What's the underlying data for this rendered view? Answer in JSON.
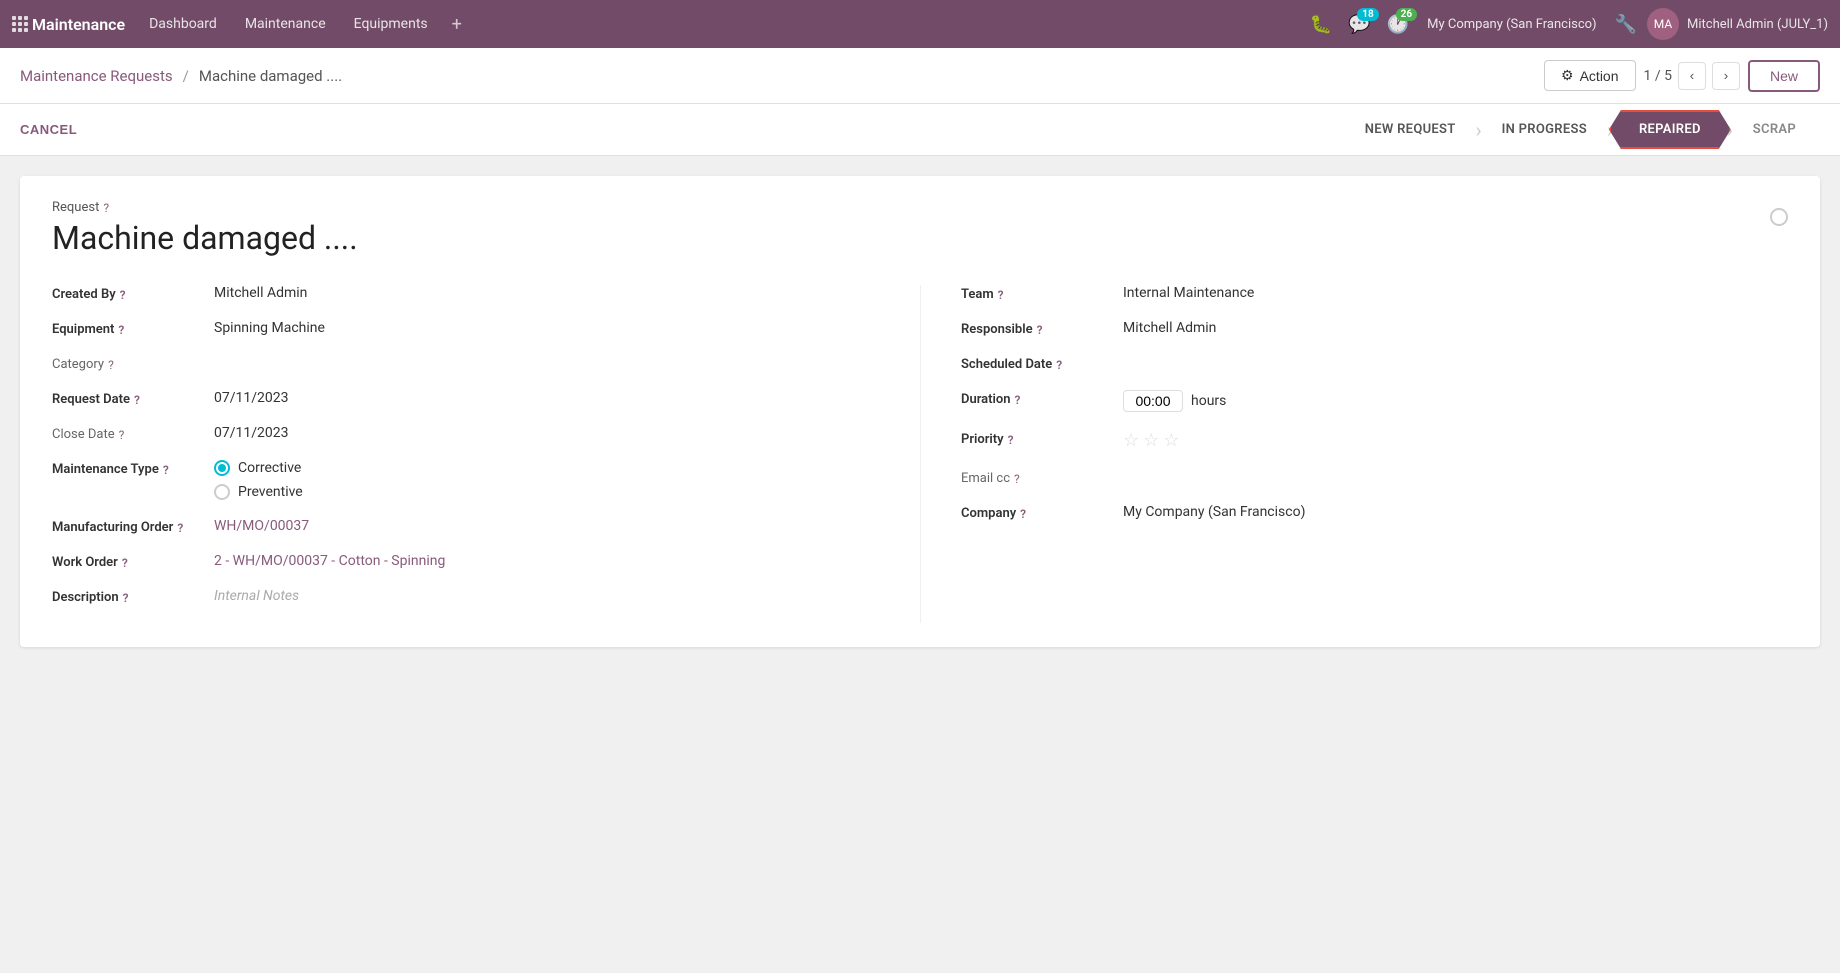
{
  "topNav": {
    "brand": "Maintenance",
    "items": [
      "Dashboard",
      "Maintenance",
      "Equipments"
    ],
    "addLabel": "+",
    "messageBadge": "18",
    "activityBadge": "26",
    "companyName": "My Company (San Francisco)",
    "userName": "Mitchell Admin (JULY_1)"
  },
  "breadcrumb": {
    "parent": "Maintenance Requests",
    "separator": "/",
    "current": "Machine damaged ...."
  },
  "toolbar": {
    "actionLabel": "Action",
    "pagination": "1 / 5",
    "newLabel": "New"
  },
  "statusBar": {
    "cancelLabel": "CANCEL",
    "steps": [
      "NEW REQUEST",
      "IN PROGRESS",
      "REPAIRED",
      "SCRAP"
    ]
  },
  "form": {
    "requestLabel": "Request",
    "title": "Machine damaged ....",
    "fields": {
      "createdByLabel": "Created By",
      "createdByValue": "Mitchell Admin",
      "equipmentLabel": "Equipment",
      "equipmentValue": "Spinning Machine",
      "categoryLabel": "Category",
      "categoryValue": "",
      "requestDateLabel": "Request Date",
      "requestDateValue": "07/11/2023",
      "closeDateLabel": "Close Date",
      "closeDateValue": "07/11/2023",
      "maintenanceTypeLabel": "Maintenance Type",
      "correctiveLabel": "Corrective",
      "preventiveLabel": "Preventive",
      "manufacturingOrderLabel": "Manufacturing Order",
      "manufacturingOrderValue": "WH/MO/00037",
      "workOrderLabel": "Work Order",
      "workOrderValue": "2 - WH/MO/00037 - Cotton - Spinning",
      "descriptionLabel": "Description",
      "descriptionPlaceholder": "Internal Notes",
      "teamLabel": "Team",
      "teamValue": "Internal Maintenance",
      "responsibleLabel": "Responsible",
      "responsibleValue": "Mitchell Admin",
      "scheduledDateLabel": "Scheduled Date",
      "scheduledDateValue": "",
      "durationLabel": "Duration",
      "durationValue": "00:00",
      "durationUnit": "hours",
      "priorityLabel": "Priority",
      "emailCcLabel": "Email cc",
      "emailCcValue": "",
      "companyLabel": "Company",
      "companyValue": "My Company (San Francisco)"
    }
  }
}
